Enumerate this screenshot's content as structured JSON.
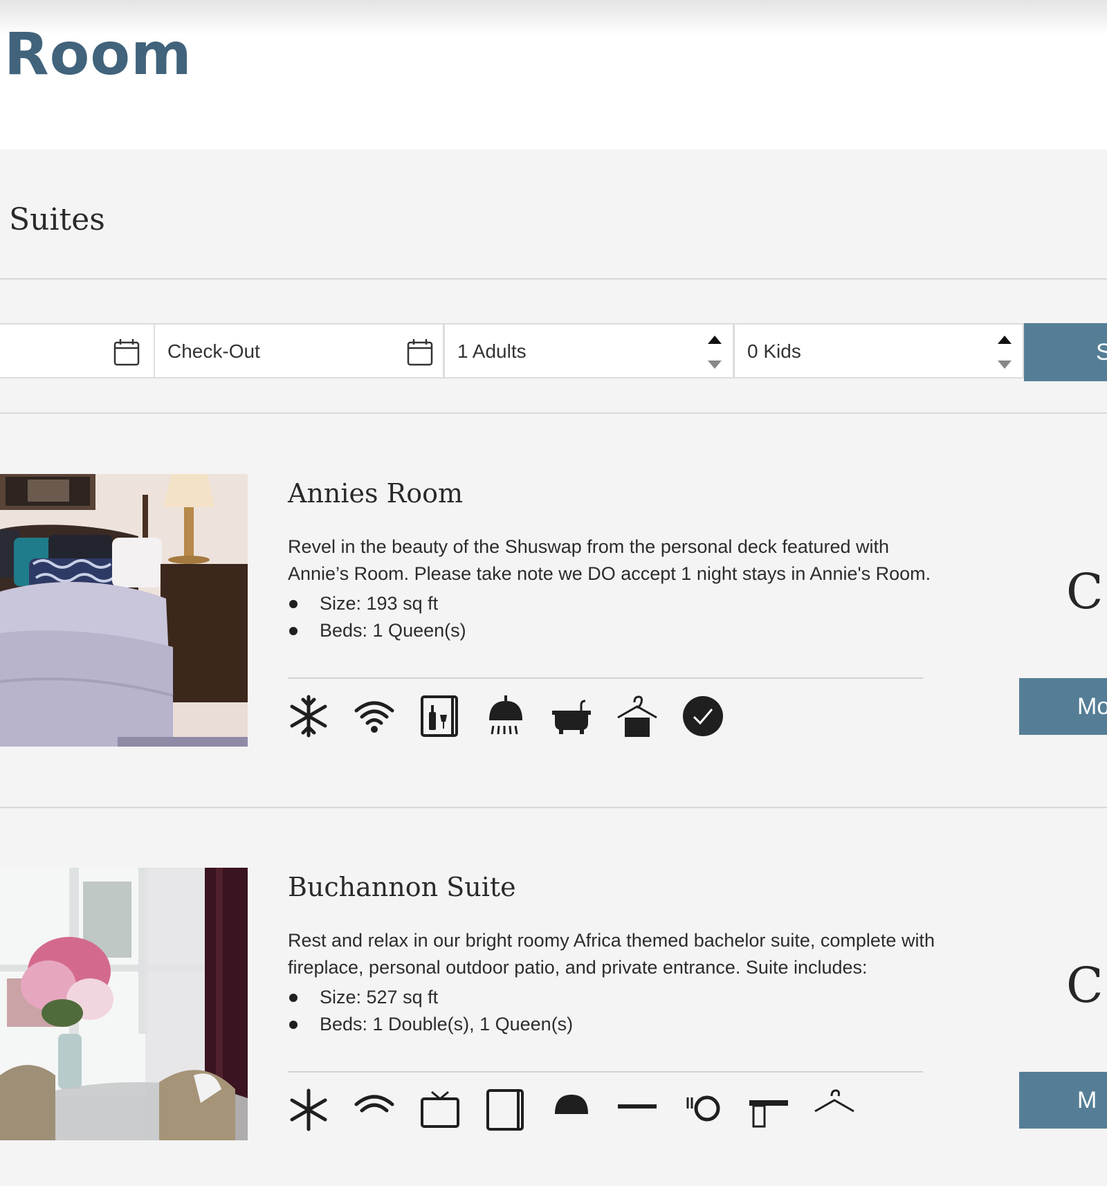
{
  "page": {
    "title": "Room"
  },
  "section": {
    "title": "Suites"
  },
  "booking": {
    "checkin_label": "",
    "checkout_label": "Check-Out",
    "adults": "1 Adults",
    "kids": "0 Kids",
    "search_label": "S"
  },
  "rooms": [
    {
      "name": "Annies Room",
      "description": "Revel in the beauty of the Shuswap from the personal deck featured with Annie’s Room. Please take note we DO accept 1 night stays in Annie's Room.",
      "features": [
        "Size: 193 sq ft",
        "Beds: 1 Queen(s)"
      ],
      "price_label": "CS",
      "more_label": "Mo",
      "amenities": [
        "snowflake-icon",
        "wifi-icon",
        "minibar-icon",
        "shower-icon",
        "bathtub-icon",
        "towel-hanger-icon",
        "check-circle-icon"
      ]
    },
    {
      "name": "Buchannon Suite",
      "description": "Rest and relax in our bright roomy Africa themed bachelor suite, complete with fireplace, personal outdoor patio, and private entrance. Suite includes:",
      "features": [
        "Size: 527 sq ft",
        "Beds: 1 Double(s), 1 Queen(s)"
      ],
      "price_label": "CS",
      "more_label": "M",
      "amenities": [
        "snowflake-icon",
        "wifi-icon",
        "tv-icon",
        "minibar-icon",
        "shower-icon",
        "bathtub-icon",
        "dining-icon",
        "desk-icon",
        "towel-hanger-icon"
      ]
    }
  ],
  "colors": {
    "accent": "#557e96",
    "title": "#41637b",
    "background": "#f4f4f4"
  }
}
